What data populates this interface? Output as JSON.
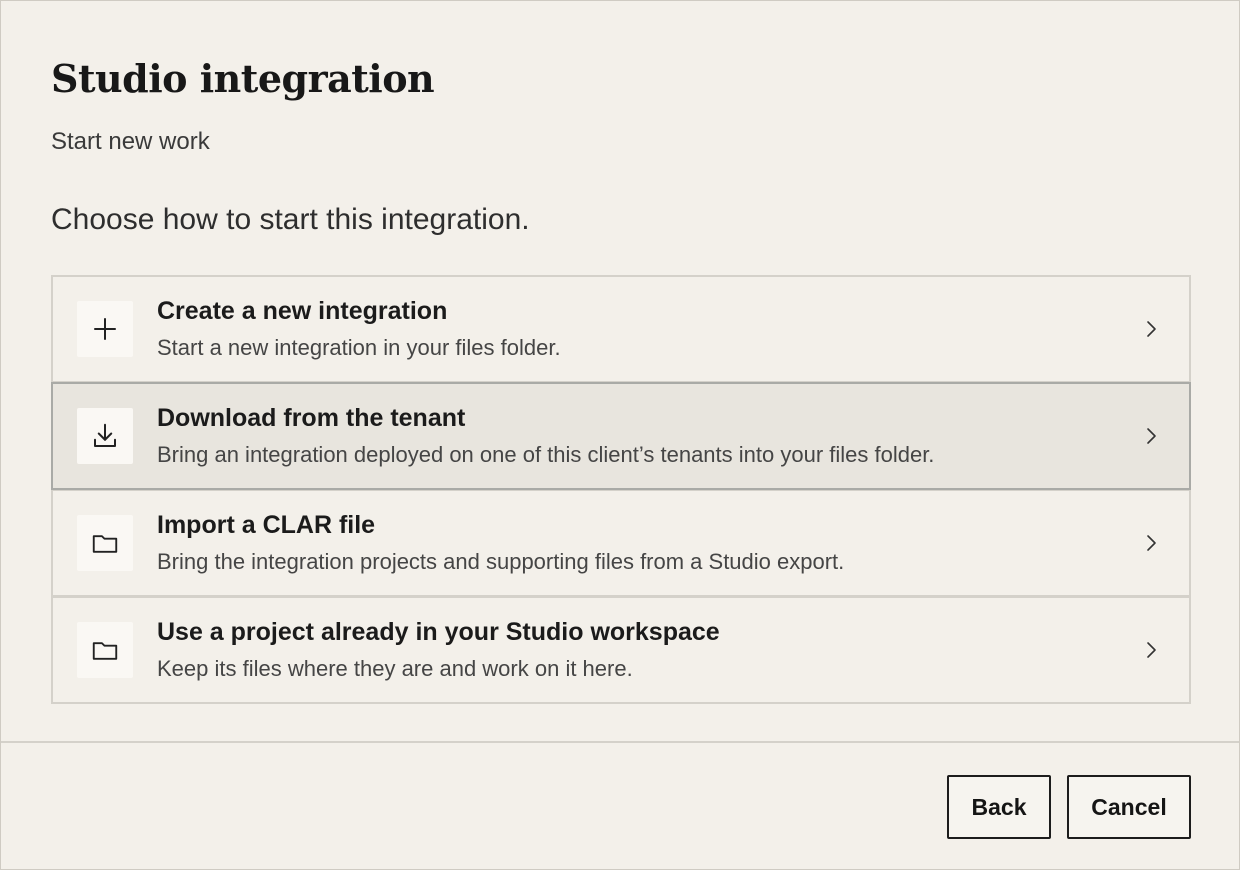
{
  "dialog": {
    "title": "Studio integration",
    "subtitle": "Start new work",
    "prompt": "Choose how to start this integration."
  },
  "options": [
    {
      "icon": "plus-icon",
      "title": "Create a new integration",
      "description": "Start a new integration in your files folder.",
      "selected": false
    },
    {
      "icon": "download-icon",
      "title": "Download from the tenant",
      "description": "Bring an integration deployed on one of this client’s tenants into your files folder.",
      "selected": true
    },
    {
      "icon": "folder-icon",
      "title": "Import a CLAR file",
      "description": "Bring the integration projects and supporting files from a Studio export.",
      "selected": false
    },
    {
      "icon": "folder-icon",
      "title": "Use a project already in your Studio workspace",
      "description": "Keep its files where they are and work on it here.",
      "selected": false
    }
  ],
  "footer": {
    "back_label": "Back",
    "cancel_label": "Cancel"
  },
  "colors": {
    "background": "#f3f0ea",
    "selected_background": "#e8e5de",
    "border": "#d4d1ca",
    "text": "#1d1d1d"
  }
}
